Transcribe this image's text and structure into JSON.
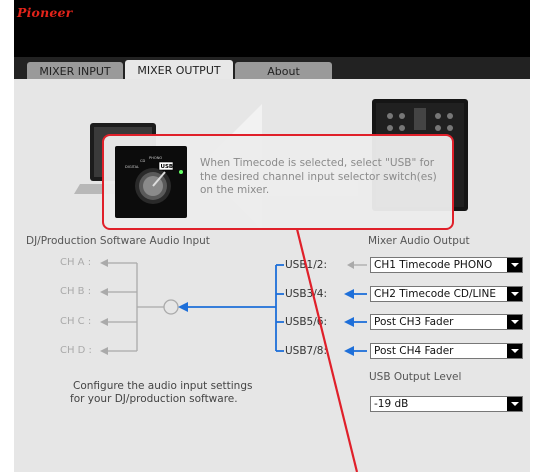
{
  "app": {
    "logo": "Pioneer"
  },
  "tabs": [
    {
      "label": "MIXER INPUT",
      "selected": false
    },
    {
      "label": "MIXER OUTPUT",
      "selected": true
    },
    {
      "label": "About",
      "selected": false
    }
  ],
  "software_input": {
    "title": "DJ/Production Software Audio Input",
    "channels": [
      "CH A :",
      "CH B :",
      "CH C :",
      "CH D :"
    ],
    "note_line1": "Configure the audio input settings",
    "note_line2": "for your DJ/production software."
  },
  "mixer_output": {
    "title": "Mixer Audio Output",
    "rows": [
      {
        "usb_label": "USB1/2:",
        "value": "CH1 Timecode PHONO"
      },
      {
        "usb_label": "USB3/4:",
        "value": "CH2 Timecode CD/LINE"
      },
      {
        "usb_label": "USB5/6:",
        "value": "Post CH3 Fader"
      },
      {
        "usb_label": "USB7/8:",
        "value": "Post CH4 Fader"
      }
    ],
    "level_label": "USB Output Level",
    "level_value": "-19 dB"
  },
  "tooltip": {
    "line1": "When Timecode is selected, select \"USB\" for",
    "line2": "the desired channel input selector switch(es)",
    "line3": "on the mixer.",
    "knob_marks": [
      "DIGITAL",
      "CD",
      "PHONO",
      "USB"
    ]
  },
  "colors": {
    "accent": "#1e6fd9",
    "callout": "#e0202a",
    "header": "#000000"
  }
}
